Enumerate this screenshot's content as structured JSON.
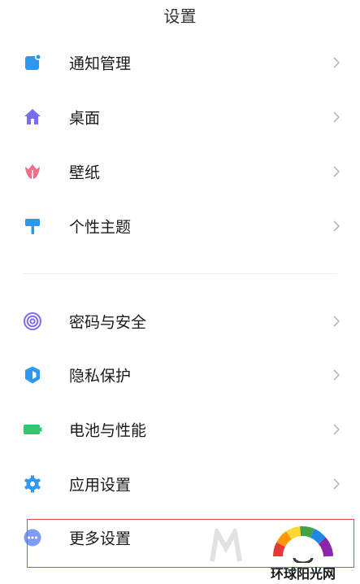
{
  "header": {
    "title": "设置"
  },
  "items": [
    {
      "label": "通知管理",
      "icon": "notification-icon",
      "color": "#2f97f2"
    },
    {
      "label": "桌面",
      "icon": "home-icon",
      "color": "#7b6cf0"
    },
    {
      "label": "壁纸",
      "icon": "tulip-icon",
      "color": "#ef6f8a"
    },
    {
      "label": "个性主题",
      "icon": "paint-roller-icon",
      "color": "#2f97f2"
    },
    {
      "label": "密码与安全",
      "icon": "fingerprint-icon",
      "color": "#7b6cf0"
    },
    {
      "label": "隐私保护",
      "icon": "shield-icon",
      "color": "#2f97f2"
    },
    {
      "label": "电池与性能",
      "icon": "battery-icon",
      "color": "#35c770"
    },
    {
      "label": "应用设置",
      "icon": "gear-icon",
      "color": "#2f97f2"
    },
    {
      "label": "更多设置",
      "icon": "more-dots-icon",
      "color": "#7f9cf5"
    }
  ],
  "watermark": {
    "logo_text": "环球阳光网"
  },
  "colors": {
    "highlight_border": "#e04a4a",
    "chevron": "#b8b8b8"
  }
}
